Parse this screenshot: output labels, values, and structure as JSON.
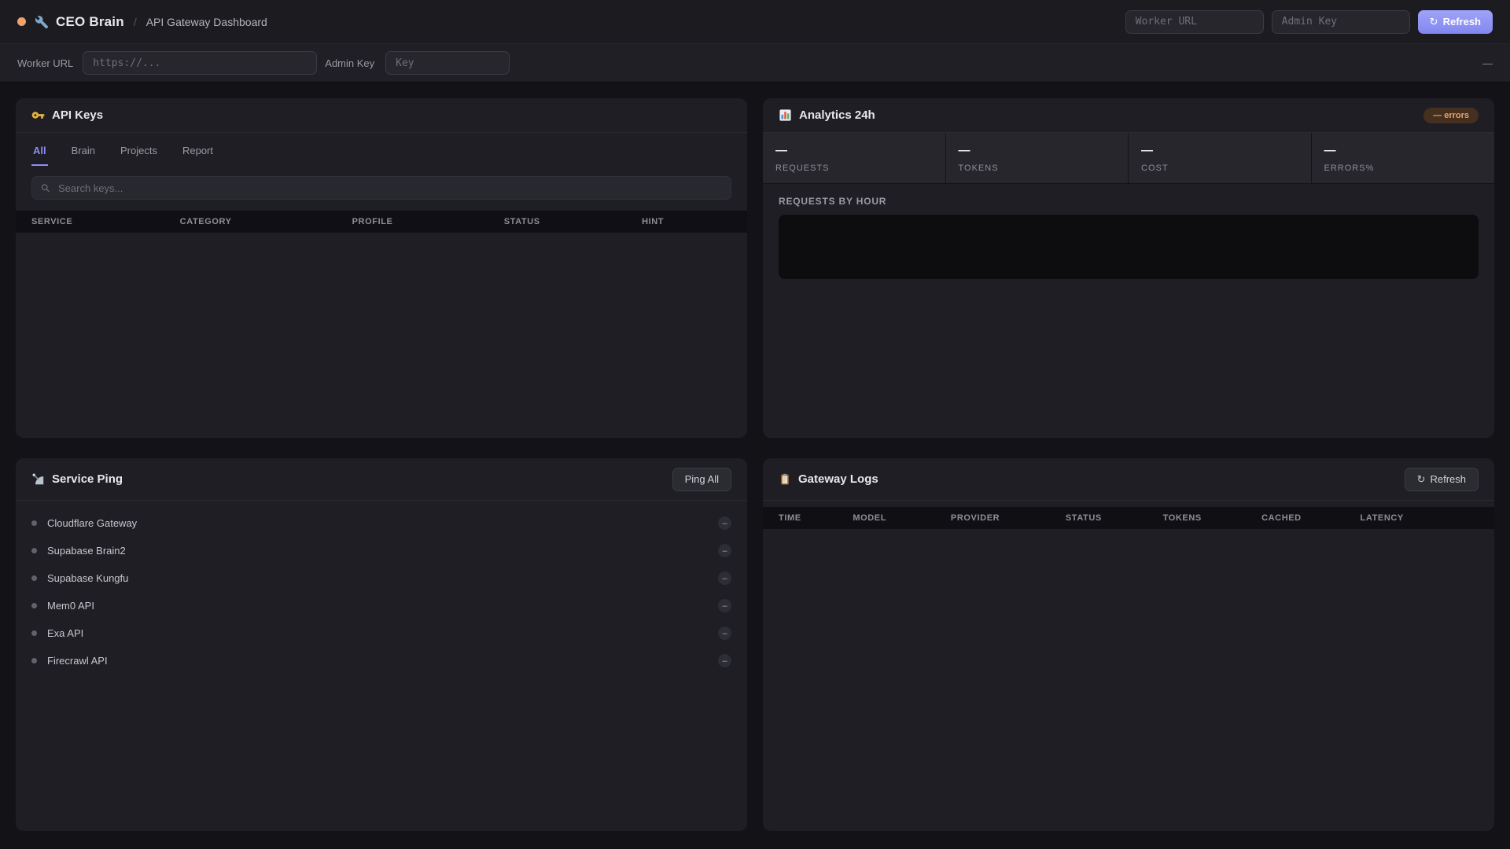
{
  "header": {
    "status_dot": "online-indicator",
    "brand_icon": "wrench-icon",
    "brand": "CEO Brain",
    "separator": "/",
    "page_title": "API Gateway Dashboard",
    "worker_url_placeholder": "Worker URL",
    "admin_key_placeholder": "Admin Key",
    "refresh_icon_glyph": "↻",
    "refresh_label": "Refresh"
  },
  "toolbar": {
    "worker_url_label": "Worker URL",
    "worker_url_placeholder": "https://...",
    "admin_key_label": "Admin Key",
    "admin_key_placeholder": "Key",
    "status_text": "—"
  },
  "api_keys": {
    "icon": "key-icon",
    "title": "API Keys",
    "tabs": [
      "All",
      "Brain",
      "Projects",
      "Report"
    ],
    "active_tab": "All",
    "search_icon": "search-icon",
    "search_placeholder": "Search keys...",
    "columns": [
      "SERVICE",
      "CATEGORY",
      "PROFILE",
      "STATUS",
      "HINT"
    ],
    "rows": []
  },
  "analytics": {
    "icon": "bar-chart-icon",
    "title": "Analytics 24h",
    "errors_badge": "— errors",
    "stats": [
      {
        "value": "—",
        "label": "REQUESTS"
      },
      {
        "value": "—",
        "label": "TOKENS"
      },
      {
        "value": "—",
        "label": "COST"
      },
      {
        "value": "—",
        "label": "ERRORS%"
      }
    ],
    "chart_title": "REQUESTS BY HOUR",
    "chart_data": {
      "type": "bar",
      "title": "REQUESTS BY HOUR",
      "x": [],
      "values": [],
      "note": "chart area is empty — no data loaded"
    }
  },
  "service_ping": {
    "icon": "satellite-icon",
    "title": "Service Ping",
    "ping_all_label": "Ping All",
    "services": [
      {
        "name": "Cloudflare Gateway",
        "status": "–"
      },
      {
        "name": "Supabase Brain2",
        "status": "–"
      },
      {
        "name": "Supabase Kungfu",
        "status": "–"
      },
      {
        "name": "Mem0 API",
        "status": "–"
      },
      {
        "name": "Exa API",
        "status": "–"
      },
      {
        "name": "Firecrawl API",
        "status": "–"
      }
    ]
  },
  "gateway_logs": {
    "icon": "clipboard-icon",
    "title": "Gateway Logs",
    "refresh_icon_glyph": "↻",
    "refresh_label": "Refresh",
    "columns": [
      "TIME",
      "MODEL",
      "PROVIDER",
      "STATUS",
      "TOKENS",
      "CACHED",
      "LATENCY"
    ],
    "rows": []
  },
  "colors": {
    "accent": "#8b8ef5",
    "page_bg": "#121217",
    "panel_bg": "#1e1e24",
    "status_dot": "#f0a26b",
    "errors_badge_bg": "#45301f",
    "errors_badge_text": "#e7a26c"
  }
}
